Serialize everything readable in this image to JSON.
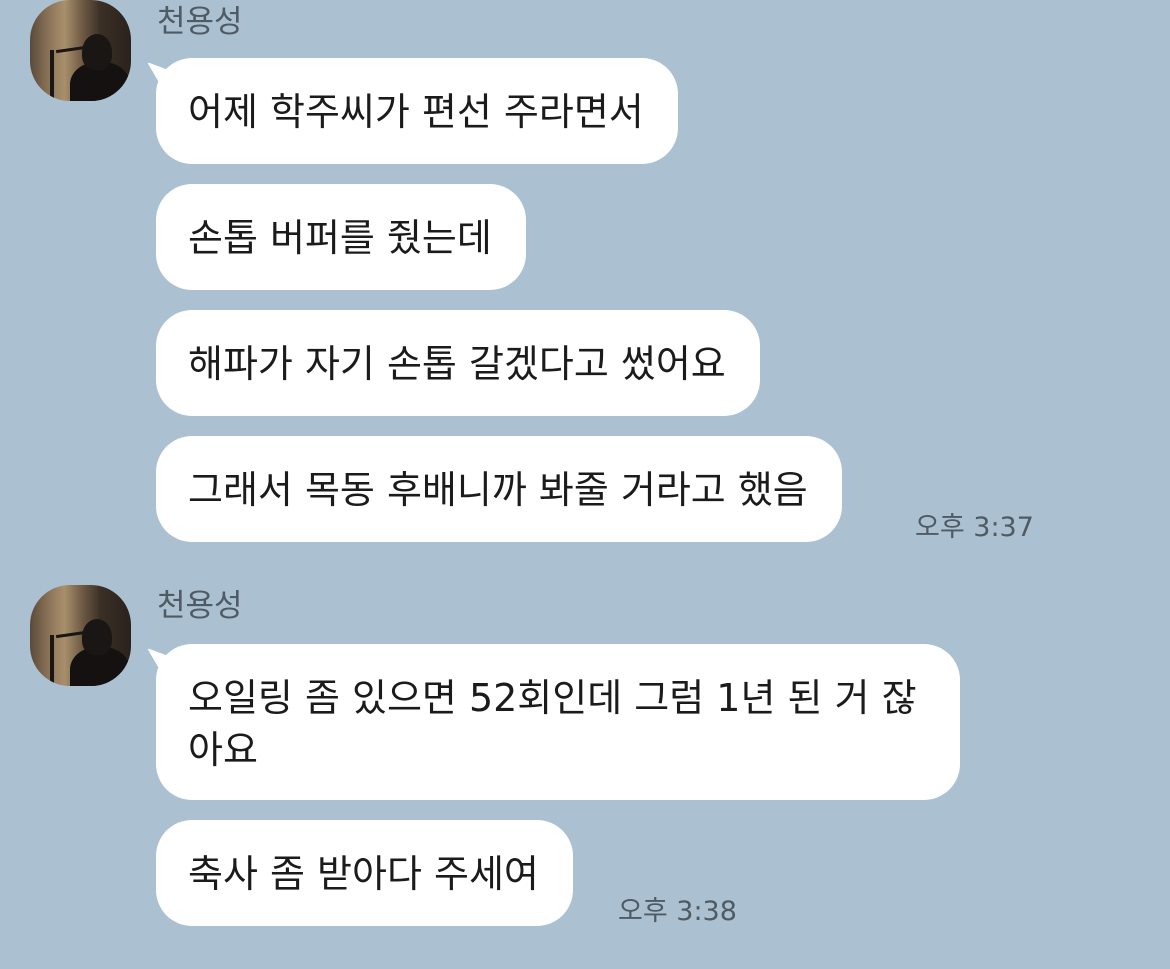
{
  "groups": [
    {
      "sender": "천용성",
      "avatar_icon": "profile-photo",
      "messages": [
        "어제 학주씨가 편선 주라면서",
        "손톱 버퍼를 줬는데",
        "해파가 자기 손톱 갈겠다고 썼어요",
        "그래서 목동 후배니까 봐줄 거라고 했음"
      ],
      "time": "오후 3:37"
    },
    {
      "sender": "천용성",
      "avatar_icon": "profile-photo",
      "messages": [
        "오일링 좀 있으면 52회인데 그럼 1년 된 거 잖아요",
        "축사 좀 받아다 주세여"
      ],
      "time": "오후 3:38"
    }
  ]
}
